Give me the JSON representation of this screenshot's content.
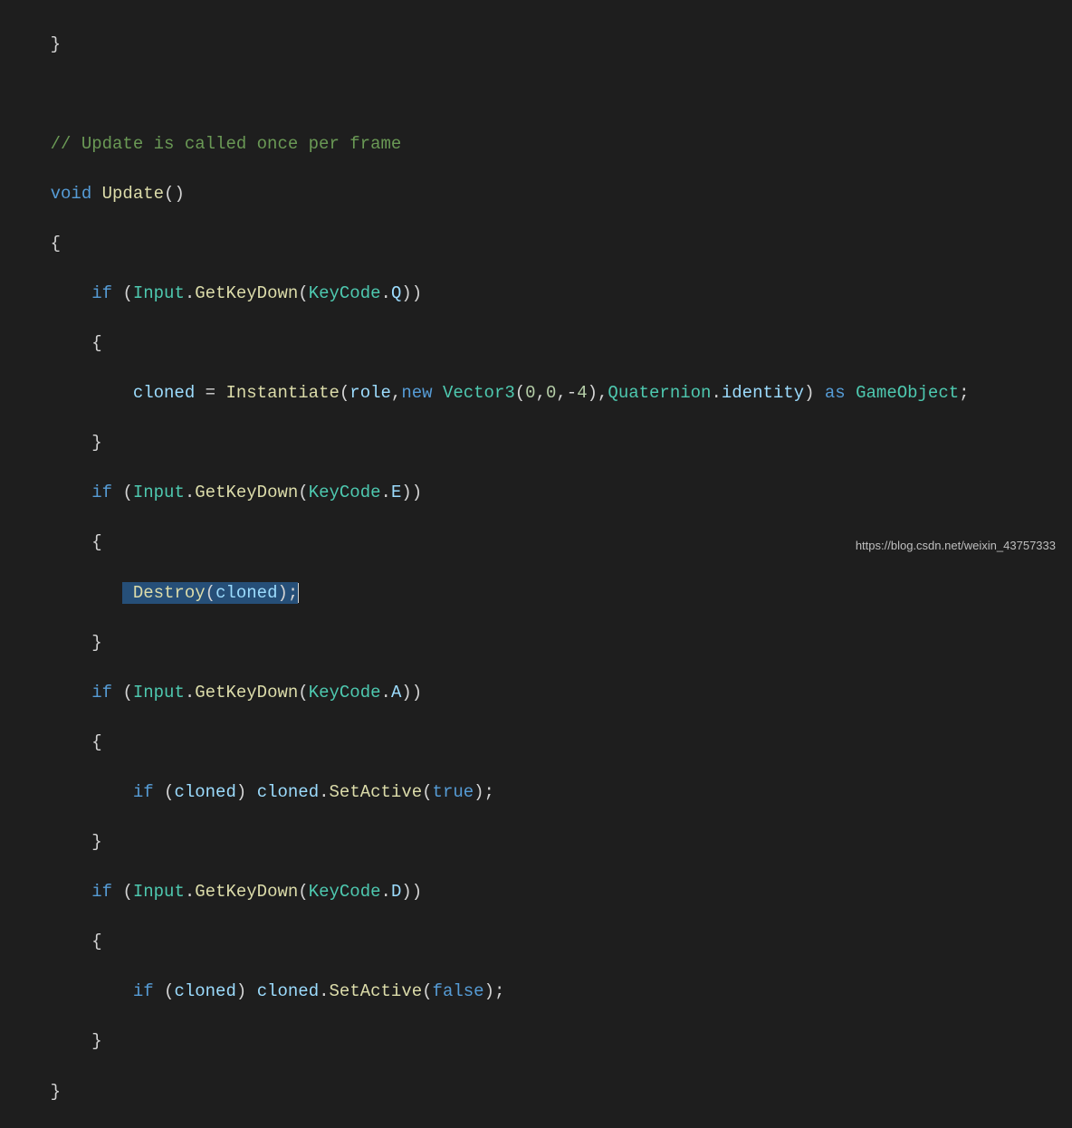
{
  "code": {
    "line0": "}",
    "line1": "",
    "comment": "// Update is called once per frame",
    "void": "void",
    "update": "Update",
    "obrace": "{",
    "cbrace": "}",
    "if": "if",
    "input": "Input",
    "getkeydown": "GetKeyDown",
    "keycode": "KeyCode",
    "keyQ": "Q",
    "keyE": "E",
    "keyA": "A",
    "keyD": "D",
    "cloned": "cloned",
    "equals": "=",
    "instantiate": "Instantiate",
    "role": "role",
    "new": "new",
    "vector3": "Vector3",
    "v0": "0",
    "v1": "0",
    "vn4": "-4",
    "quaternion": "Quaternion",
    "identity": "identity",
    "as": "as",
    "gameobject": "GameObject",
    "destroy": "Destroy",
    "setactive": "SetActive",
    "true": "true",
    "false": "false"
  },
  "watermark": "https://blog.csdn.net/weixin_43757333"
}
